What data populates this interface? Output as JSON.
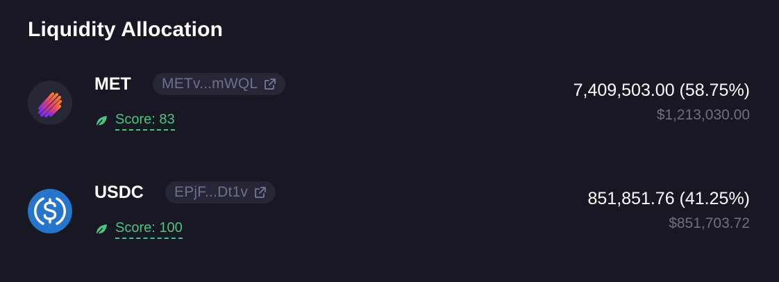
{
  "header": {
    "title": "Liquidity Allocation"
  },
  "tokens": [
    {
      "symbol": "MET",
      "address_short": "METv...mWQL",
      "logo_icon": "meteora-logo-icon",
      "score_label": "Score: 83",
      "amount_text": "7,409,503.00 (58.75%)",
      "usd_value": "$1,213,030.00"
    },
    {
      "symbol": "USDC",
      "address_short": "EPjF...Dt1v",
      "logo_icon": "usdc-logo-icon",
      "score_label": "Score: 100",
      "amount_text": "851,851.76 (41.25%)",
      "usd_value": "$851,703.72"
    }
  ],
  "colors": {
    "background": "#181824",
    "pill": "#262637",
    "score_green": "#4ec27f",
    "muted_text": "#6f6f82",
    "usdc_blue": "#2775ca"
  }
}
